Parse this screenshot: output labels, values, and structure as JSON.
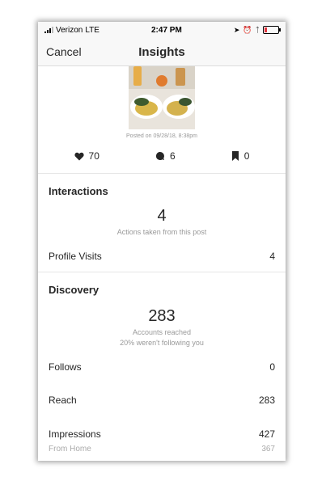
{
  "status": {
    "carrier": "Verizon",
    "network": "LTE",
    "time": "2:47 PM",
    "battery_level": 0.2,
    "battery_color": "#e0333c"
  },
  "nav": {
    "cancel_label": "Cancel",
    "title": "Insights"
  },
  "post": {
    "posted_text": "Posted on 09/28/18, 8:38pm"
  },
  "stats": {
    "likes": "70",
    "comments": "6",
    "saves": "0"
  },
  "interactions": {
    "title": "Interactions",
    "actions_count": "4",
    "actions_label": "Actions taken from this post",
    "profile_visits_label": "Profile Visits",
    "profile_visits_value": "4"
  },
  "discovery": {
    "title": "Discovery",
    "reach_count": "283",
    "reach_label": "Accounts reached",
    "reach_sub": "20% weren't following you",
    "follows_label": "Follows",
    "follows_value": "0",
    "reach_row_label": "Reach",
    "reach_row_value": "283",
    "impressions_label": "Impressions",
    "impressions_value": "427",
    "from_home_label": "From Home",
    "from_home_value": "367"
  },
  "icons": {
    "likes": "heart-icon",
    "comments": "comment-bubble-icon",
    "saves": "bookmark-icon"
  }
}
